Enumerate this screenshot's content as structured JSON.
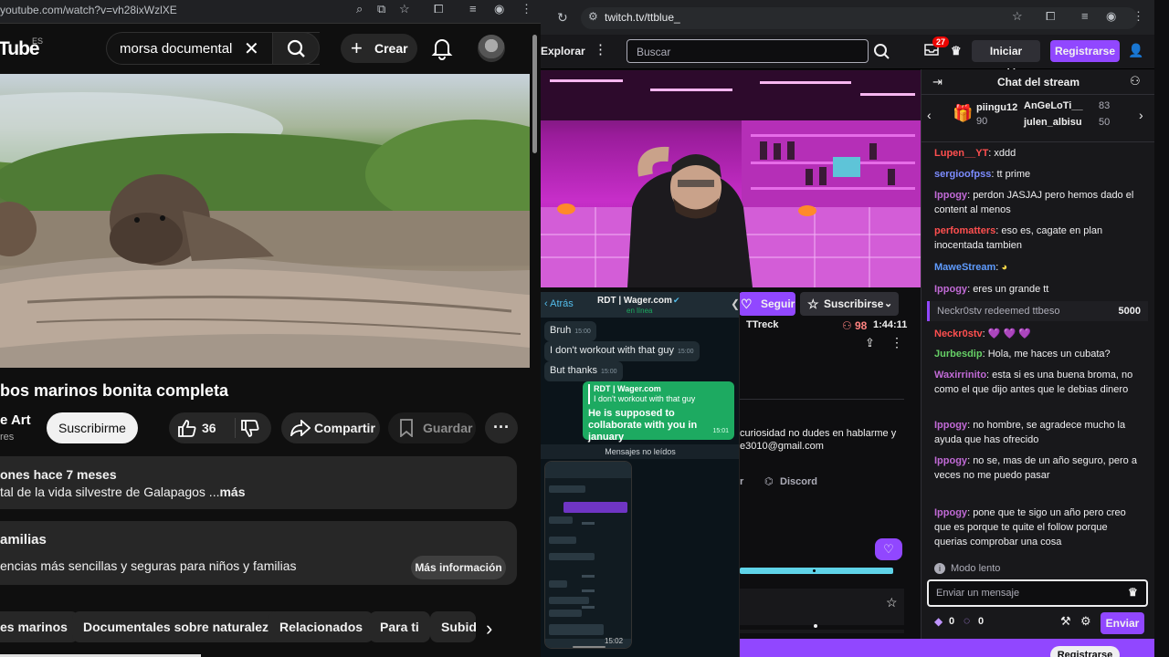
{
  "youtube": {
    "url": "youtube.com/watch?v=vh28ixWzlXE",
    "logo": "Tube",
    "logo_region": "ES",
    "search_value": "morsa documental",
    "create_label": "Crear",
    "title": "bos marinos bonita completa",
    "channel": "e Art",
    "subs": "res",
    "subscribe_label": "Suscribirme",
    "like_count": "36",
    "share_label": "Compartir",
    "save_label": "Guardar",
    "desc_meta": "ones  hace 7 meses",
    "desc_text": "tal de la vida silvestre de Galapagos ...",
    "desc_more": "más",
    "promo_title": "amilias",
    "promo_text": "encias más sencillas y seguras para niños y familias",
    "promo_button": "Más información",
    "chips": [
      "es marinos",
      "Documentales sobre naturaleza",
      "Relacionados",
      "Para ti",
      "Subid"
    ]
  },
  "twitch": {
    "url": "twitch.tv/ttblue_",
    "explore": "Explorar",
    "search_placeholder": "Buscar",
    "notif_count": "27",
    "login_label": "Iniciar sesión",
    "register_label": "Registrarse",
    "follow_label": "Seguir",
    "subscribe_label": "Suscribirse",
    "streamer": "TTreck",
    "viewers": "98",
    "uptime": "1:44:11",
    "about_text": "curiosidad no dudes en hablarme y",
    "about_email": "e3010@gmail.com",
    "link_r": "r",
    "discord": "Discord",
    "chat_title": "Chat del stream",
    "leaderboard": [
      {
        "name": "piingu12",
        "value": "90"
      },
      {
        "name": "AnGeLoTi__",
        "value": "83"
      },
      {
        "name": "julen_albisu",
        "value": "50"
      }
    ],
    "chat": [
      {
        "user": "Lupen__YT",
        "color": "#ff4f4f",
        "text": "xddd"
      },
      {
        "user": "sergioofpss",
        "color": "#7c8cff",
        "text": "tt prime"
      },
      {
        "user": "Ippogy",
        "color": "#c16ad6",
        "text": "perdon JASJAJ pero hemos dado el content al menos"
      },
      {
        "user": "perfomatters",
        "color": "#ff4f4f",
        "text": "eso es, cagate en plan inocentada tambien"
      },
      {
        "user": "MaweStream",
        "color": "#5f9cff",
        "text": ""
      },
      {
        "user": "Ippogy",
        "color": "#c16ad6",
        "text": "eres un grande tt"
      },
      {
        "user": "Neckr0stv",
        "color": "#ff4f4f",
        "text": "💜 💜 💜"
      },
      {
        "user": "Jurbesdip",
        "color": "#66d066",
        "text": "Hola, me haces un cubata?"
      },
      {
        "user": "Waxirrinito",
        "color": "#c16ad6",
        "text": "esta si es una buena broma, no como el que dijo antes que le debias dinero"
      },
      {
        "user": "Ippogy",
        "color": "#c16ad6",
        "text": "no hombre, se agradece mucho la ayuda que has ofrecido"
      },
      {
        "user": "Ippogy",
        "color": "#c16ad6",
        "text": "no se, mas de un año seguro, pero a veces no me puedo pasar"
      },
      {
        "user": "Ippogy",
        "color": "#c16ad6",
        "text": "pone que te sigo un año pero creo que es porque te quite el follow porque querias comprobar una cosa"
      }
    ],
    "redeem_text": "Neckr0stv redeemed ttbeso",
    "redeem_cost": "5000",
    "slow_mode": "Modo lento",
    "input_placeholder": "Enviar un mensaje",
    "points": "0",
    "points2": "0",
    "send_label": "Enviar",
    "bottom_register": "Registrarse"
  },
  "whatsapp": {
    "back": "Atrás",
    "contact": "RDT | Wager.com",
    "status": "en línea",
    "messages": [
      {
        "text": "Bruh",
        "time": "15:00"
      },
      {
        "text": "I don't workout with that guy",
        "time": "15:00"
      },
      {
        "text": "But thanks",
        "time": "15:00"
      }
    ],
    "reply_quote_name": "RDT | Wager.com",
    "reply_quote_text": "I don't workout with that guy",
    "reply_text": "He is supposed to collaborate with you in january",
    "reply_time": "15:01",
    "unread": "Mensajes no leídos",
    "phone_time": "15:02"
  }
}
